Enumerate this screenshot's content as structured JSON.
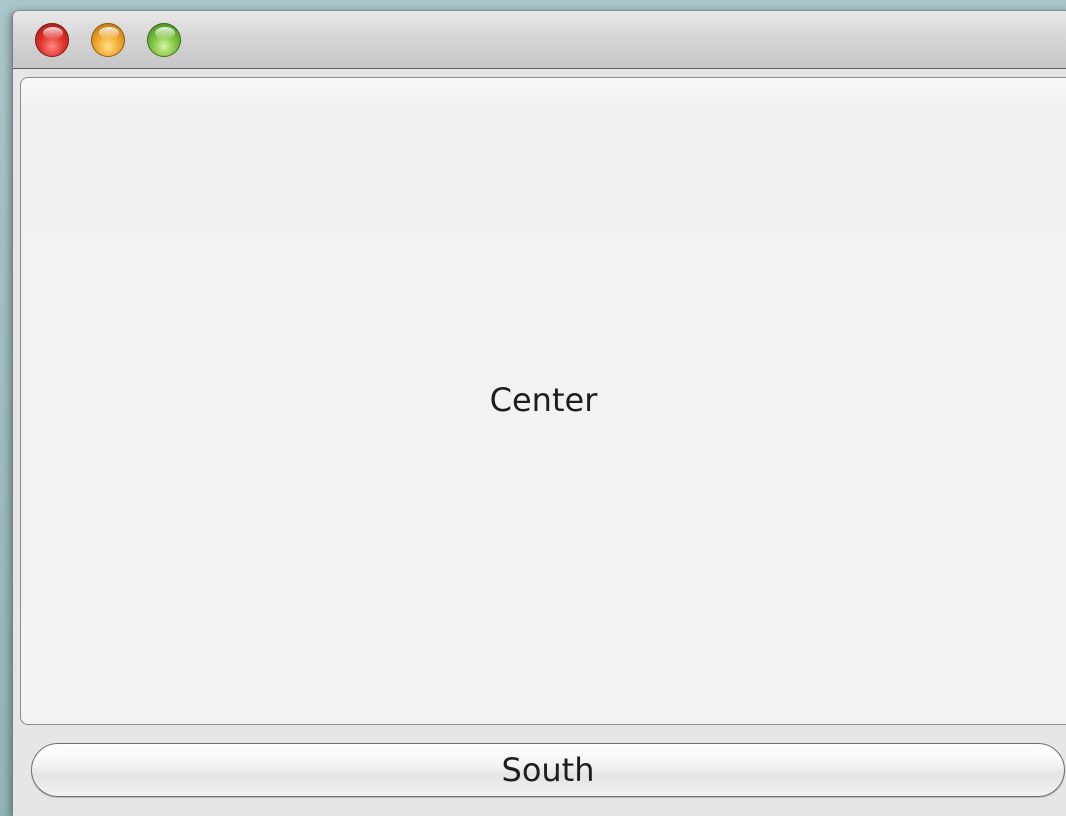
{
  "window": {
    "controls": [
      {
        "name": "close",
        "color": "#e0312b"
      },
      {
        "name": "minimize",
        "color": "#f0a52a"
      },
      {
        "name": "zoom",
        "color": "#7cc23e"
      }
    ]
  },
  "center": {
    "label": "Center"
  },
  "south": {
    "label": "South"
  }
}
